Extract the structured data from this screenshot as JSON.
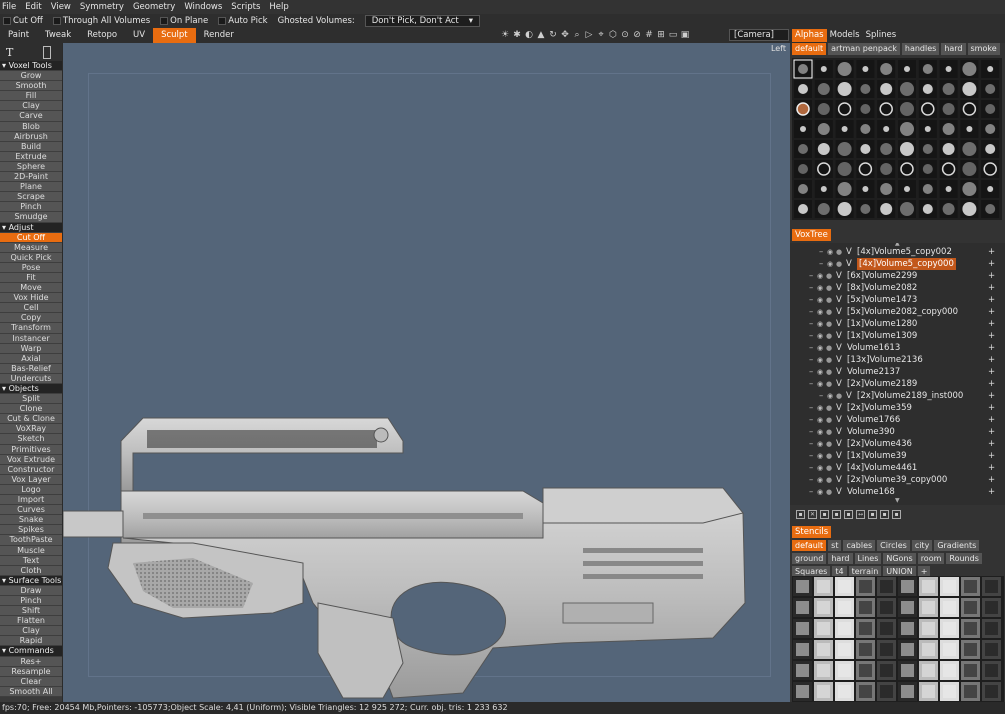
{
  "menu": [
    "File",
    "Edit",
    "View",
    "Symmetry",
    "Geometry",
    "Windows",
    "Scripts",
    "Help"
  ],
  "toolbar": {
    "cut_off": "Cut Off",
    "through_all": "Through All Volumes",
    "on_plane": "On Plane",
    "auto_pick": "Auto Pick",
    "ghosted_label": "Ghosted Volumes:",
    "ghosted_value": "Don't Pick, Don't Act"
  },
  "modes": [
    "Paint",
    "Tweak",
    "Retopo",
    "UV",
    "Sculpt",
    "Render"
  ],
  "active_mode": "Sculpt",
  "camera": "[Camera]",
  "viewport_label": "Left",
  "right_tabs": [
    "Alphas",
    "Models",
    "Splines"
  ],
  "alpha_tabs": [
    "default",
    "artman penpack",
    "handles",
    "hard",
    "smoke"
  ],
  "voxtree_title": "VoxTree",
  "stencils_title": "Stencils",
  "stencil_tabs": [
    "default",
    "st",
    "cables",
    "Circles",
    "city",
    "Gradients",
    "ground",
    "hard",
    "Lines",
    "NGons",
    "room",
    "Rounds",
    "Squares",
    "t4",
    "terrain",
    "UNION"
  ],
  "left_panel": [
    {
      "label": "Voxel Tools",
      "kind": "section"
    },
    {
      "label": "Grow"
    },
    {
      "label": "Smooth"
    },
    {
      "label": "Fill"
    },
    {
      "label": "Clay"
    },
    {
      "label": "Carve"
    },
    {
      "label": "Blob"
    },
    {
      "label": "Airbrush"
    },
    {
      "label": "Build"
    },
    {
      "label": "Extrude"
    },
    {
      "label": "Sphere"
    },
    {
      "label": "2D-Paint"
    },
    {
      "label": "Plane"
    },
    {
      "label": "Scrape"
    },
    {
      "label": "Pinch"
    },
    {
      "label": "Smudge"
    },
    {
      "label": "Adjust",
      "kind": "section"
    },
    {
      "label": "Cut Off",
      "kind": "active"
    },
    {
      "label": "Measure"
    },
    {
      "label": "Quick Pick"
    },
    {
      "label": "Pose"
    },
    {
      "label": "Fit"
    },
    {
      "label": "Move"
    },
    {
      "label": "Vox Hide"
    },
    {
      "label": "Cell"
    },
    {
      "label": "Copy"
    },
    {
      "label": "Transform"
    },
    {
      "label": "Instancer"
    },
    {
      "label": "Warp"
    },
    {
      "label": "Axial"
    },
    {
      "label": "Bas-Relief"
    },
    {
      "label": "Undercuts"
    },
    {
      "label": "Objects",
      "kind": "section"
    },
    {
      "label": "Split"
    },
    {
      "label": "Clone"
    },
    {
      "label": "Cut & Clone"
    },
    {
      "label": "VoXRay"
    },
    {
      "label": "Sketch"
    },
    {
      "label": "Primitives"
    },
    {
      "label": "Vox Extrude"
    },
    {
      "label": "Constructor"
    },
    {
      "label": "Vox Layer"
    },
    {
      "label": "Logo"
    },
    {
      "label": "Import"
    },
    {
      "label": "Curves"
    },
    {
      "label": "Snake"
    },
    {
      "label": "Spikes"
    },
    {
      "label": "ToothPaste"
    },
    {
      "label": "Muscle"
    },
    {
      "label": "Text"
    },
    {
      "label": "Cloth"
    },
    {
      "label": "Surface Tools",
      "kind": "section"
    },
    {
      "label": "Draw"
    },
    {
      "label": "Pinch"
    },
    {
      "label": "Shift"
    },
    {
      "label": "Flatten"
    },
    {
      "label": "Clay"
    },
    {
      "label": "Rapid"
    },
    {
      "label": "Commands",
      "kind": "section"
    },
    {
      "label": "Res+"
    },
    {
      "label": "Resample"
    },
    {
      "label": "Clear"
    },
    {
      "label": "Smooth All"
    }
  ],
  "voxtree": [
    {
      "name": "[4x]Volume5_copy002",
      "indent": 1
    },
    {
      "name": "[4x]Volume5_copy000",
      "indent": 1,
      "selected": true
    },
    {
      "name": "[6x]Volume2299",
      "indent": 0
    },
    {
      "name": "[8x]Volume2082",
      "indent": 0
    },
    {
      "name": "[5x]Volume1473",
      "indent": 0
    },
    {
      "name": "[5x]Volume2082_copy000",
      "indent": 0
    },
    {
      "name": "[1x]Volume1280",
      "indent": 0
    },
    {
      "name": "[1x]Volume1309",
      "indent": 0
    },
    {
      "name": "Volume1613",
      "indent": 0
    },
    {
      "name": "[13x]Volume2136",
      "indent": 0
    },
    {
      "name": "Volume2137",
      "indent": 0
    },
    {
      "name": "[2x]Volume2189",
      "indent": 0
    },
    {
      "name": "[2x]Volume2189_inst000",
      "indent": 1
    },
    {
      "name": "[2x]Volume359",
      "indent": 0
    },
    {
      "name": "Volume1766",
      "indent": 0
    },
    {
      "name": "Volume390",
      "indent": 0
    },
    {
      "name": "[2x]Volume436",
      "indent": 0
    },
    {
      "name": "[1x]Volume39",
      "indent": 0
    },
    {
      "name": "[4x]Volume4461",
      "indent": 0
    },
    {
      "name": "[2x]Volume39_copy000",
      "indent": 0
    },
    {
      "name": "Volume168",
      "indent": 0
    }
  ],
  "status": "fps:70;    Free: 20454 Mb,Pointers: -105773;Object Scale: 4,41 (Uniform); Visible Triangles: 12 925 272; Curr. obj. tris: 1 233 632",
  "colors": {
    "accent": "#e86c10",
    "viewport_bg": "#546579"
  }
}
